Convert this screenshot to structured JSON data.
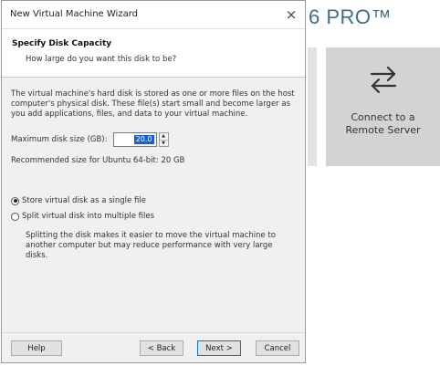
{
  "background": {
    "title": "6 PRO™",
    "tile": {
      "icon": "swap-arrows-icon",
      "label_line1": "Connect to a",
      "label_line2": "Remote Server"
    }
  },
  "dialog": {
    "window_title": "New Virtual Machine Wizard",
    "close_glyph": "×",
    "header_title": "Specify Disk Capacity",
    "header_subtitle": "How large do you want this disk to be?",
    "description": "The virtual machine's hard disk is stored as one or more files on the host computer's physical disk. These file(s) start small and become larger as you add applications, files, and data to your virtual machine.",
    "max_size_label": "Maximum disk size (GB):",
    "max_size_value": "20.0",
    "recommended": "Recommended size for Ubuntu 64-bit: 20 GB",
    "option_single": "Store virtual disk as a single file",
    "option_split": "Split virtual disk into multiple files",
    "split_note": "Splitting the disk makes it easier to move the virtual machine to another computer but may reduce performance with very large disks.",
    "selected_option": "single",
    "buttons": {
      "help": "Help",
      "back": "< Back",
      "next": "Next >",
      "cancel": "Cancel"
    }
  },
  "colors": {
    "accent": "#0078d7",
    "selection": "#1a5fd0",
    "brand_text": "#3d6f88",
    "tile_bg": "#d3d3d3"
  }
}
